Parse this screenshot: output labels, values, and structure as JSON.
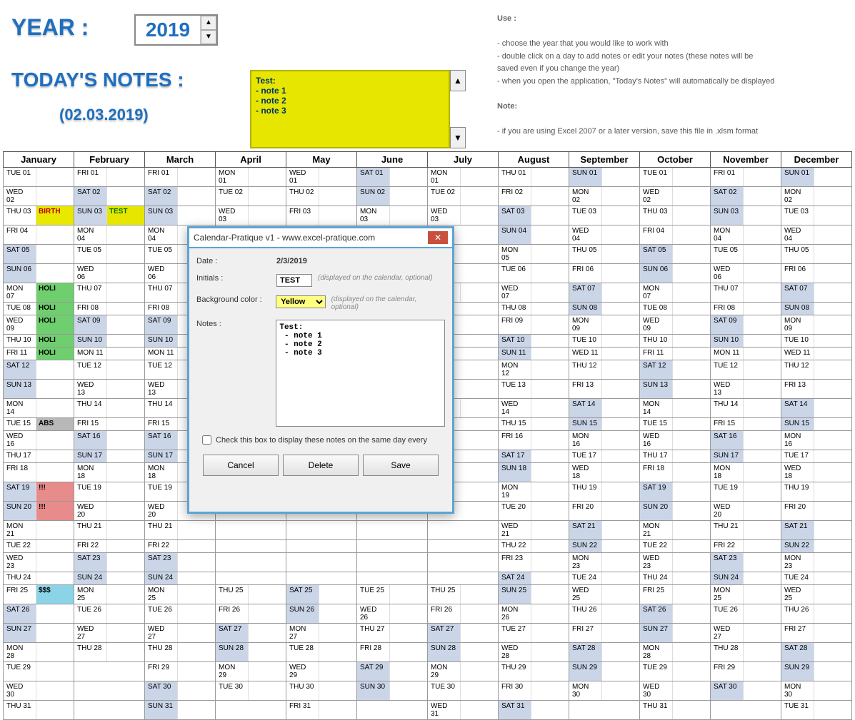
{
  "header": {
    "year_label": "YEAR :",
    "year_value": "2019",
    "notes_label": "TODAY'S NOTES :",
    "notes_date": "(02.03.2019)",
    "notes_content": "Test:\n - note 1\n - note 2\n - note 3"
  },
  "help": {
    "use_title": "Use :",
    "use_lines": [
      "- choose the year that you would like to work with",
      "- double click on a day to add notes or edit your notes (these notes will be",
      "   saved even if you change the year)",
      "- when you open the application, \"Today's Notes\" will automatically be displayed"
    ],
    "note_title": "Note:",
    "note_line": "- if you are using Excel 2007 or a later version, save this file in .xlsm format"
  },
  "months": [
    "January",
    "February",
    "March",
    "April",
    "May",
    "June",
    "July",
    "August",
    "September",
    "October",
    "November",
    "December"
  ],
  "calendar": {
    "jan": [
      {
        "d": "TUE 01"
      },
      {
        "d": "WED 02"
      },
      {
        "d": "THU 03",
        "note": "BIRTH",
        "cls": "hl-birth"
      },
      {
        "d": "FRI 04"
      },
      {
        "d": "SAT 05",
        "wk": true
      },
      {
        "d": "SUN 06",
        "wk": true
      },
      {
        "d": "MON 07",
        "note": "HOLI",
        "cls": "hl-holi"
      },
      {
        "d": "TUE 08",
        "note": "HOLI",
        "cls": "hl-holi"
      },
      {
        "d": "WED 09",
        "note": "HOLI",
        "cls": "hl-holi"
      },
      {
        "d": "THU 10",
        "note": "HOLI",
        "cls": "hl-holi"
      },
      {
        "d": "FRI 11",
        "note": "HOLI",
        "cls": "hl-holi"
      },
      {
        "d": "SAT 12",
        "wk": true
      },
      {
        "d": "SUN 13",
        "wk": true
      },
      {
        "d": "MON 14"
      },
      {
        "d": "TUE 15",
        "note": "ABS",
        "cls": "hl-abs"
      },
      {
        "d": "WED 16"
      },
      {
        "d": "THU 17"
      },
      {
        "d": "FRI 18"
      },
      {
        "d": "SAT 19",
        "wk": true,
        "note": "!!!",
        "cls": "hl-ex"
      },
      {
        "d": "SUN 20",
        "wk": true,
        "note": "!!!",
        "cls": "hl-ex"
      },
      {
        "d": "MON 21"
      },
      {
        "d": "TUE 22"
      },
      {
        "d": "WED 23"
      },
      {
        "d": "THU 24"
      },
      {
        "d": "FRI 25",
        "note": "$$$",
        "cls": "hl-dol"
      },
      {
        "d": "SAT 26",
        "wk": true
      },
      {
        "d": "SUN 27",
        "wk": true
      },
      {
        "d": "MON 28"
      },
      {
        "d": "TUE 29"
      },
      {
        "d": "WED 30"
      },
      {
        "d": "THU 31"
      }
    ],
    "feb": [
      {
        "d": "FRI 01"
      },
      {
        "d": "SAT 02",
        "wk": true
      },
      {
        "d": "SUN 03",
        "wk": true,
        "note": "TEST",
        "cls": "hl-test"
      },
      {
        "d": "MON 04"
      },
      {
        "d": "TUE 05"
      },
      {
        "d": "WED 06"
      },
      {
        "d": "THU 07"
      },
      {
        "d": "FRI 08"
      },
      {
        "d": "SAT 09",
        "wk": true
      },
      {
        "d": "SUN 10",
        "wk": true
      },
      {
        "d": "MON 11"
      },
      {
        "d": "TUE 12"
      },
      {
        "d": "WED 13"
      },
      {
        "d": "THU 14"
      },
      {
        "d": "FRI 15"
      },
      {
        "d": "SAT 16",
        "wk": true
      },
      {
        "d": "SUN 17",
        "wk": true
      },
      {
        "d": "MON 18"
      },
      {
        "d": "TUE 19"
      },
      {
        "d": "WED 20"
      },
      {
        "d": "THU 21"
      },
      {
        "d": "FRI 22"
      },
      {
        "d": "SAT 23",
        "wk": true
      },
      {
        "d": "SUN 24",
        "wk": true
      },
      {
        "d": "MON 25"
      },
      {
        "d": "TUE 26"
      },
      {
        "d": "WED 27"
      },
      {
        "d": "THU 28"
      }
    ],
    "mar": [
      {
        "d": "FRI 01"
      },
      {
        "d": "SAT 02",
        "wk": true
      },
      {
        "d": "SUN 03",
        "wk": true
      },
      {
        "d": "MON 04"
      },
      {
        "d": "TUE 05"
      },
      {
        "d": "WED 06"
      },
      {
        "d": "THU 07"
      },
      {
        "d": "FRI 08"
      },
      {
        "d": "SAT 09",
        "wk": true
      },
      {
        "d": "SUN 10",
        "wk": true
      },
      {
        "d": "MON 11"
      },
      {
        "d": "TUE 12"
      },
      {
        "d": "WED 13"
      },
      {
        "d": "THU 14"
      },
      {
        "d": "FRI 15"
      },
      {
        "d": "SAT 16",
        "wk": true
      },
      {
        "d": "SUN 17",
        "wk": true
      },
      {
        "d": "MON 18"
      },
      {
        "d": "TUE 19"
      },
      {
        "d": "WED 20"
      },
      {
        "d": "THU 21"
      },
      {
        "d": "FRI 22"
      },
      {
        "d": "SAT 23",
        "wk": true
      },
      {
        "d": "SUN 24",
        "wk": true
      },
      {
        "d": "MON 25"
      },
      {
        "d": "TUE 26"
      },
      {
        "d": "WED 27"
      },
      {
        "d": "THU 28"
      },
      {
        "d": "FRI 29"
      },
      {
        "d": "SAT 30",
        "wk": true
      },
      {
        "d": "SUN 31",
        "wk": true
      }
    ],
    "apr": [
      {
        "d": "MON 01"
      },
      {
        "d": "TUE 02"
      },
      {
        "d": "WED 03"
      },
      {
        "d": "",
        "blank": true
      },
      {
        "d": "",
        "blank": true
      },
      {
        "d": "",
        "blank": true
      },
      {
        "d": "",
        "blank": true
      },
      {
        "d": "",
        "blank": true
      },
      {
        "d": "",
        "blank": true
      },
      {
        "d": "",
        "blank": true
      },
      {
        "d": "",
        "blank": true
      },
      {
        "d": "",
        "blank": true
      },
      {
        "d": "",
        "blank": true
      },
      {
        "d": "",
        "blank": true
      },
      {
        "d": "",
        "blank": true
      },
      {
        "d": "",
        "blank": true
      },
      {
        "d": "",
        "blank": true
      },
      {
        "d": "",
        "blank": true
      },
      {
        "d": "",
        "blank": true
      },
      {
        "d": "",
        "blank": true
      },
      {
        "d": "",
        "blank": true
      },
      {
        "d": "",
        "blank": true
      },
      {
        "d": "",
        "blank": true
      },
      {
        "d": "",
        "blank": true
      },
      {
        "d": "THU 25"
      },
      {
        "d": "FRI 26"
      },
      {
        "d": "SAT 27",
        "wk": true
      },
      {
        "d": "SUN 28",
        "wk": true
      },
      {
        "d": "MON 29"
      },
      {
        "d": "TUE 30"
      }
    ],
    "may": [
      {
        "d": "WED 01"
      },
      {
        "d": "THU 02"
      },
      {
        "d": "FRI 03"
      },
      {
        "d": "",
        "blank": true
      },
      {
        "d": "",
        "blank": true
      },
      {
        "d": "",
        "blank": true
      },
      {
        "d": "",
        "blank": true
      },
      {
        "d": "",
        "blank": true
      },
      {
        "d": "",
        "blank": true
      },
      {
        "d": "",
        "blank": true
      },
      {
        "d": "",
        "blank": true
      },
      {
        "d": "",
        "blank": true
      },
      {
        "d": "",
        "blank": true
      },
      {
        "d": "",
        "blank": true
      },
      {
        "d": "",
        "blank": true
      },
      {
        "d": "",
        "blank": true
      },
      {
        "d": "",
        "blank": true
      },
      {
        "d": "",
        "blank": true
      },
      {
        "d": "",
        "blank": true
      },
      {
        "d": "",
        "blank": true
      },
      {
        "d": "",
        "blank": true
      },
      {
        "d": "",
        "blank": true
      },
      {
        "d": "",
        "blank": true
      },
      {
        "d": "",
        "blank": true
      },
      {
        "d": "SAT 25",
        "wk": true
      },
      {
        "d": "SUN 26",
        "wk": true
      },
      {
        "d": "MON 27"
      },
      {
        "d": "TUE 28"
      },
      {
        "d": "WED 29"
      },
      {
        "d": "THU 30"
      },
      {
        "d": "FRI 31"
      }
    ],
    "jun": [
      {
        "d": "SAT 01",
        "wk": true
      },
      {
        "d": "SUN 02",
        "wk": true
      },
      {
        "d": "MON 03"
      },
      {
        "d": "",
        "blank": true
      },
      {
        "d": "",
        "blank": true
      },
      {
        "d": "",
        "blank": true
      },
      {
        "d": "",
        "blank": true
      },
      {
        "d": "",
        "blank": true
      },
      {
        "d": "",
        "blank": true
      },
      {
        "d": "",
        "blank": true
      },
      {
        "d": "",
        "blank": true
      },
      {
        "d": "",
        "blank": true
      },
      {
        "d": "",
        "blank": true
      },
      {
        "d": "",
        "blank": true
      },
      {
        "d": "",
        "blank": true
      },
      {
        "d": "",
        "blank": true
      },
      {
        "d": "",
        "blank": true
      },
      {
        "d": "",
        "blank": true
      },
      {
        "d": "",
        "blank": true
      },
      {
        "d": "",
        "blank": true
      },
      {
        "d": "",
        "blank": true
      },
      {
        "d": "",
        "blank": true
      },
      {
        "d": "",
        "blank": true
      },
      {
        "d": "",
        "blank": true
      },
      {
        "d": "TUE 25"
      },
      {
        "d": "WED 26"
      },
      {
        "d": "THU 27"
      },
      {
        "d": "FRI 28"
      },
      {
        "d": "SAT 29",
        "wk": true
      },
      {
        "d": "SUN 30",
        "wk": true
      }
    ],
    "jul": [
      {
        "d": "MON 01"
      },
      {
        "d": "TUE 02"
      },
      {
        "d": "WED 03"
      },
      {
        "d": "",
        "blank": true
      },
      {
        "d": "",
        "blank": true
      },
      {
        "d": "",
        "blank": true
      },
      {
        "d": "WED 07"
      },
      {
        "d": "",
        "blank": true
      },
      {
        "d": "",
        "blank": true
      },
      {
        "d": "",
        "blank": true
      },
      {
        "d": "",
        "blank": true
      },
      {
        "d": "",
        "blank": true
      },
      {
        "d": "",
        "blank": true
      },
      {
        "d": "WED 14"
      },
      {
        "d": "",
        "blank": true
      },
      {
        "d": "",
        "blank": true
      },
      {
        "d": "",
        "blank": true
      },
      {
        "d": "",
        "blank": true
      },
      {
        "d": "",
        "blank": true
      },
      {
        "d": "",
        "blank": true
      },
      {
        "d": "",
        "blank": true
      },
      {
        "d": "",
        "blank": true
      },
      {
        "d": "",
        "blank": true
      },
      {
        "d": "",
        "blank": true
      },
      {
        "d": "THU 25"
      },
      {
        "d": "FRI 26"
      },
      {
        "d": "SAT 27",
        "wk": true
      },
      {
        "d": "SUN 28",
        "wk": true
      },
      {
        "d": "MON 29"
      },
      {
        "d": "TUE 30"
      },
      {
        "d": "WED 31"
      }
    ],
    "aug": [
      {
        "d": "THU 01"
      },
      {
        "d": "FRI 02"
      },
      {
        "d": "SAT 03",
        "wk": true
      },
      {
        "d": "SUN 04",
        "wk": true
      },
      {
        "d": "MON 05"
      },
      {
        "d": "TUE 06"
      },
      {
        "d": "WED 07"
      },
      {
        "d": "THU 08"
      },
      {
        "d": "FRI 09"
      },
      {
        "d": "SAT 10",
        "wk": true
      },
      {
        "d": "SUN 11",
        "wk": true
      },
      {
        "d": "MON 12"
      },
      {
        "d": "TUE 13"
      },
      {
        "d": "WED 14"
      },
      {
        "d": "THU 15"
      },
      {
        "d": "FRI 16"
      },
      {
        "d": "SAT 17",
        "wk": true
      },
      {
        "d": "SUN 18",
        "wk": true
      },
      {
        "d": "MON 19"
      },
      {
        "d": "TUE 20"
      },
      {
        "d": "WED 21"
      },
      {
        "d": "THU 22"
      },
      {
        "d": "FRI 23"
      },
      {
        "d": "SAT 24",
        "wk": true
      },
      {
        "d": "SUN 25",
        "wk": true
      },
      {
        "d": "MON 26"
      },
      {
        "d": "TUE 27"
      },
      {
        "d": "WED 28"
      },
      {
        "d": "THU 29"
      },
      {
        "d": "FRI 30"
      },
      {
        "d": "SAT 31",
        "wk": true
      }
    ],
    "sep": [
      {
        "d": "SUN 01",
        "wk": true
      },
      {
        "d": "MON 02"
      },
      {
        "d": "TUE 03"
      },
      {
        "d": "WED 04"
      },
      {
        "d": "THU 05"
      },
      {
        "d": "FRI 06"
      },
      {
        "d": "SAT 07",
        "wk": true
      },
      {
        "d": "SUN 08",
        "wk": true
      },
      {
        "d": "MON 09"
      },
      {
        "d": "TUE 10"
      },
      {
        "d": "WED 11"
      },
      {
        "d": "THU 12"
      },
      {
        "d": "FRI 13"
      },
      {
        "d": "SAT 14",
        "wk": true
      },
      {
        "d": "SUN 15",
        "wk": true
      },
      {
        "d": "MON 16"
      },
      {
        "d": "TUE 17"
      },
      {
        "d": "WED 18"
      },
      {
        "d": "THU 19"
      },
      {
        "d": "FRI 20"
      },
      {
        "d": "SAT 21",
        "wk": true
      },
      {
        "d": "SUN 22",
        "wk": true
      },
      {
        "d": "MON 23"
      },
      {
        "d": "TUE 24"
      },
      {
        "d": "WED 25"
      },
      {
        "d": "THU 26"
      },
      {
        "d": "FRI 27"
      },
      {
        "d": "SAT 28",
        "wk": true
      },
      {
        "d": "SUN 29",
        "wk": true
      },
      {
        "d": "MON 30"
      }
    ],
    "oct": [
      {
        "d": "TUE 01"
      },
      {
        "d": "WED 02"
      },
      {
        "d": "THU 03"
      },
      {
        "d": "FRI 04"
      },
      {
        "d": "SAT 05",
        "wk": true
      },
      {
        "d": "SUN 06",
        "wk": true
      },
      {
        "d": "MON 07"
      },
      {
        "d": "TUE 08"
      },
      {
        "d": "WED 09"
      },
      {
        "d": "THU 10"
      },
      {
        "d": "FRI 11"
      },
      {
        "d": "SAT 12",
        "wk": true
      },
      {
        "d": "SUN 13",
        "wk": true
      },
      {
        "d": "MON 14"
      },
      {
        "d": "TUE 15"
      },
      {
        "d": "WED 16"
      },
      {
        "d": "THU 17"
      },
      {
        "d": "FRI 18"
      },
      {
        "d": "SAT 19",
        "wk": true
      },
      {
        "d": "SUN 20",
        "wk": true
      },
      {
        "d": "MON 21"
      },
      {
        "d": "TUE 22"
      },
      {
        "d": "WED 23"
      },
      {
        "d": "THU 24"
      },
      {
        "d": "FRI 25"
      },
      {
        "d": "SAT 26",
        "wk": true
      },
      {
        "d": "SUN 27",
        "wk": true
      },
      {
        "d": "MON 28"
      },
      {
        "d": "TUE 29"
      },
      {
        "d": "WED 30"
      },
      {
        "d": "THU 31"
      }
    ],
    "nov": [
      {
        "d": "FRI 01"
      },
      {
        "d": "SAT 02",
        "wk": true
      },
      {
        "d": "SUN 03",
        "wk": true
      },
      {
        "d": "MON 04"
      },
      {
        "d": "TUE 05"
      },
      {
        "d": "WED 06"
      },
      {
        "d": "THU 07"
      },
      {
        "d": "FRI 08"
      },
      {
        "d": "SAT 09",
        "wk": true
      },
      {
        "d": "SUN 10",
        "wk": true
      },
      {
        "d": "MON 11"
      },
      {
        "d": "TUE 12"
      },
      {
        "d": "WED 13"
      },
      {
        "d": "THU 14"
      },
      {
        "d": "FRI 15"
      },
      {
        "d": "SAT 16",
        "wk": true
      },
      {
        "d": "SUN 17",
        "wk": true
      },
      {
        "d": "MON 18"
      },
      {
        "d": "TUE 19"
      },
      {
        "d": "WED 20"
      },
      {
        "d": "THU 21"
      },
      {
        "d": "FRI 22"
      },
      {
        "d": "SAT 23",
        "wk": true
      },
      {
        "d": "SUN 24",
        "wk": true
      },
      {
        "d": "MON 25"
      },
      {
        "d": "TUE 26"
      },
      {
        "d": "WED 27"
      },
      {
        "d": "THU 28"
      },
      {
        "d": "FRI 29"
      },
      {
        "d": "SAT 30",
        "wk": true
      }
    ],
    "dec": [
      {
        "d": "SUN 01",
        "wk": true
      },
      {
        "d": "MON 02"
      },
      {
        "d": "TUE 03"
      },
      {
        "d": "WED 04"
      },
      {
        "d": "THU 05"
      },
      {
        "d": "FRI 06"
      },
      {
        "d": "SAT 07",
        "wk": true
      },
      {
        "d": "SUN 08",
        "wk": true
      },
      {
        "d": "MON 09"
      },
      {
        "d": "TUE 10"
      },
      {
        "d": "WED 11"
      },
      {
        "d": "THU 12"
      },
      {
        "d": "FRI 13"
      },
      {
        "d": "SAT 14",
        "wk": true
      },
      {
        "d": "SUN 15",
        "wk": true
      },
      {
        "d": "MON 16"
      },
      {
        "d": "TUE 17"
      },
      {
        "d": "WED 18"
      },
      {
        "d": "THU 19"
      },
      {
        "d": "FRI 20"
      },
      {
        "d": "SAT 21",
        "wk": true
      },
      {
        "d": "SUN 22",
        "wk": true
      },
      {
        "d": "MON 23"
      },
      {
        "d": "TUE 24"
      },
      {
        "d": "WED 25"
      },
      {
        "d": "THU 26"
      },
      {
        "d": "FRI 27"
      },
      {
        "d": "SAT 28",
        "wk": true
      },
      {
        "d": "SUN 29",
        "wk": true
      },
      {
        "d": "MON 30"
      },
      {
        "d": "TUE 31"
      }
    ]
  },
  "dialog": {
    "title": "Calendar-Pratique v1 - www.excel-pratique.com",
    "date_label": "Date :",
    "date_value": "2/3/2019",
    "initials_label": "Initials :",
    "initials_value": "TEST",
    "initials_hint": "(displayed on the calendar, optional)",
    "bgcolor_label": "Background color :",
    "bgcolor_value": "Yellow",
    "bgcolor_hint": "(displayed on the calendar, optional)",
    "notes_label": "Notes :",
    "notes_value": "Test:\n - note 1\n - note 2\n - note 3",
    "checkbox_label": "Check this box to display these notes on the same day every",
    "btn_cancel": "Cancel",
    "btn_delete": "Delete",
    "btn_save": "Save"
  }
}
